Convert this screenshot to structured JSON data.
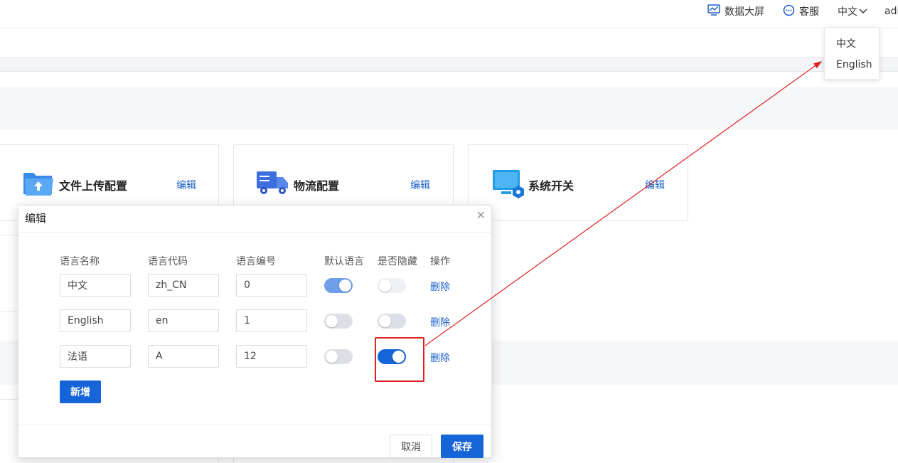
{
  "header": {
    "dashboard_label": "数据大屏",
    "service_label": "客服",
    "language_current": "中文",
    "user_label": "adr"
  },
  "language_menu": {
    "options": [
      "中文",
      "English"
    ]
  },
  "cards": [
    {
      "title": "文件上传配置",
      "edit_label": "编辑",
      "icon": "folder-upload-icon"
    },
    {
      "title": "物流配置",
      "edit_label": "编辑",
      "icon": "delivery-truck-icon"
    },
    {
      "title": "系统开关",
      "edit_label": "编辑",
      "icon": "monitor-settings-icon"
    }
  ],
  "modal": {
    "title": "编辑",
    "columns": [
      "语言名称",
      "语言代码",
      "语言编号",
      "默认语言",
      "是否隐藏",
      "操作"
    ],
    "rows": [
      {
        "name": "中文",
        "code": "zh_CN",
        "number": "0",
        "is_default": true,
        "is_hidden": false,
        "action_label": "删除"
      },
      {
        "name": "English",
        "code": "en",
        "number": "1",
        "is_default": false,
        "is_hidden": false,
        "action_label": "删除"
      },
      {
        "name": "法语",
        "code": "A",
        "number": "12",
        "is_default": false,
        "is_hidden": true,
        "action_label": "删除"
      }
    ],
    "add_label": "新增",
    "cancel_label": "取消",
    "save_label": "保存"
  },
  "colors": {
    "primary": "#1565d8",
    "link": "#1a5fc9",
    "toggle_on": "#1565d8",
    "toggle_on_soft": "#6f9ee8",
    "annotation": "#e02020"
  }
}
